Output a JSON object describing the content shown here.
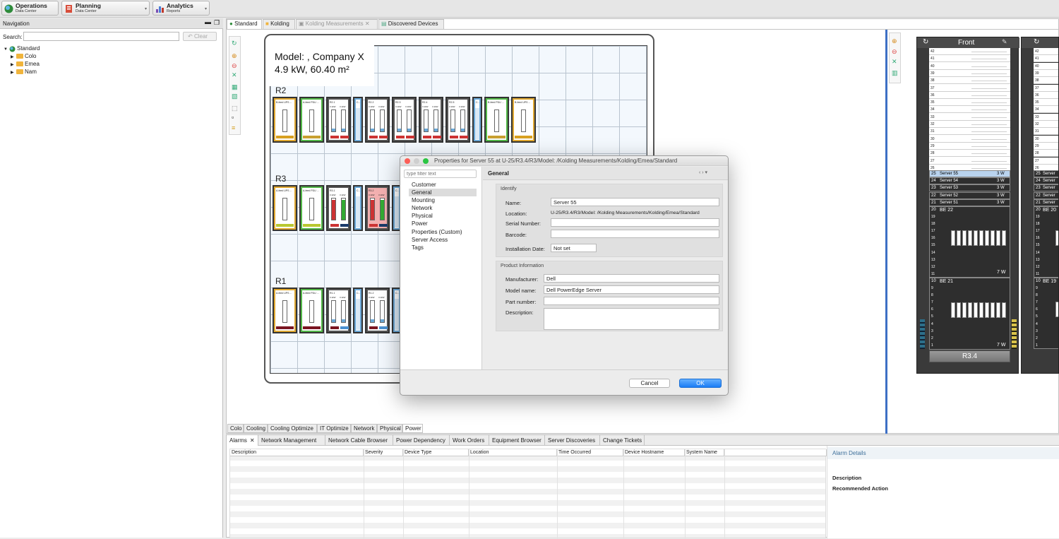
{
  "perspectives": [
    {
      "title": "Operations",
      "subtitle": "Data Center"
    },
    {
      "title": "Planning",
      "subtitle": "Data Center"
    },
    {
      "title": "Analytics",
      "subtitle": "Reports"
    }
  ],
  "nav": {
    "title": "Navigation",
    "search_label": "Search:",
    "clear_label": "Clear",
    "tree": [
      {
        "label": "Standard"
      },
      {
        "label": "Colo"
      },
      {
        "label": "Emea"
      },
      {
        "label": "Nam"
      }
    ]
  },
  "editor_tabs": [
    "Standard",
    "Kolding",
    "Kolding Measurements",
    "Discovered Devices"
  ],
  "floor": {
    "title_line1": "Model: ,  Company X",
    "title_line2": "4.9 kW,  60.40 m²",
    "rows": [
      "R2",
      "R3",
      "R1"
    ]
  },
  "floor_racks": {
    "r2": [
      "B-feed UPS ...",
      "A-feed PDU ...",
      "R2.1",
      "C...",
      "R2.2",
      "R2.3",
      "R2.4",
      "R2.5",
      "C...",
      "B-feed PDU ...",
      "B-feed UPS ..."
    ],
    "r3": [
      "A-feed UPS ...",
      "A-feed PDU ...",
      "R3.1",
      "C...",
      "R3.2",
      "C..."
    ],
    "r1": [
      "A-feed UPS ...",
      "A-feed PDU ...",
      "R1.1",
      "C...",
      "R1.2",
      "C..."
    ],
    "kw": "3.1kW"
  },
  "bottom_view_tabs": [
    "Colo",
    "Cooling",
    "Cooling Optimize",
    "IT Optimize",
    "Network",
    "Physical",
    "Power"
  ],
  "dialog": {
    "title": "Properties for Server 55 at U-25/R3.4/R3/Model: /Kolding Measurements/Kolding/Emea/Standard",
    "filter_placeholder": "type filter text",
    "categories": [
      "Customer",
      "General",
      "Mounting",
      "Network",
      "Physical",
      "Power",
      "Properties (Custom)",
      "Server Access",
      "Tags"
    ],
    "page_title": "General",
    "identify_title": "Identify",
    "name_label": "Name:",
    "name_value": "Server 55",
    "location_label": "Location:",
    "location_value": "U-25/R3.4/R3/Model: /Kolding Measurements/Kolding/Emea/Standard",
    "serial_label": "Serial Number:",
    "barcode_label": "Barcode:",
    "install_label": "Installation Date:",
    "install_value": "Not set",
    "product_title": "Product Information",
    "manufacturer_label": "Manufacturer:",
    "manufacturer_value": "Dell",
    "model_label": "Model name:",
    "model_value": "Dell PowerEdge Server",
    "part_label": "Part number:",
    "description_label": "Description:",
    "cancel": "Cancel",
    "ok": "OK"
  },
  "rack": {
    "face": "Front",
    "name": "R3.4",
    "empty_units": [
      "42",
      "41",
      "40",
      "39",
      "38",
      "37",
      "36",
      "35",
      "34",
      "33",
      "32",
      "31",
      "30",
      "29",
      "28",
      "27",
      "26"
    ],
    "servers": [
      {
        "u": "25",
        "name": "Server 55",
        "power": "3 W"
      },
      {
        "u": "24",
        "name": "Server 54",
        "power": "3 W"
      },
      {
        "u": "23",
        "name": "Server 53",
        "power": "3 W"
      },
      {
        "u": "22",
        "name": "Server 52",
        "power": "3 W"
      },
      {
        "u": "21",
        "name": "Server 51",
        "power": "3 W"
      }
    ],
    "be1": {
      "u": "20",
      "name": "BE 22",
      "units": [
        "19",
        "18",
        "17",
        "16",
        "15",
        "14",
        "13",
        "12",
        "11"
      ],
      "power": "7 W"
    },
    "be2": {
      "u": "10",
      "name": "BE 21",
      "units": [
        "9",
        "8",
        "7",
        "6",
        "5",
        "4",
        "3",
        "2",
        "1"
      ],
      "power": "7 W"
    },
    "right_units": [
      "42",
      "41",
      "40",
      "39",
      "38",
      "37",
      "36",
      "35",
      "34",
      "33",
      "32",
      "31",
      "30",
      "29",
      "28",
      "27",
      "26"
    ],
    "right_servers": [
      "25",
      "24",
      "23",
      "22",
      "21"
    ],
    "right_server_label": "Server",
    "right_be1": "BE 20",
    "right_be1_u": "20",
    "right_be2": "BE 19",
    "right_be2_u": "10",
    "right_units_lower": [
      "19",
      "18",
      "17",
      "16",
      "15",
      "14",
      "13",
      "12",
      "11"
    ],
    "right_units_lower2": [
      "9",
      "8",
      "7",
      "6",
      "5",
      "4",
      "3",
      "2",
      "1"
    ]
  },
  "bottom_tabs": [
    "Alarms",
    "Network Management",
    "Network Cable Browser",
    "Power Dependency",
    "Work Orders",
    "Equipment Browser",
    "Server Discoveries",
    "Change Tickets"
  ],
  "alarm_columns": [
    "Description",
    "Severity",
    "Device Type",
    "Location",
    "Time Occurred",
    "Device Hostname",
    "System Name"
  ],
  "alarm_details": {
    "title": "Alarm Details",
    "description": "Description",
    "recommended": "Recommended Action"
  }
}
